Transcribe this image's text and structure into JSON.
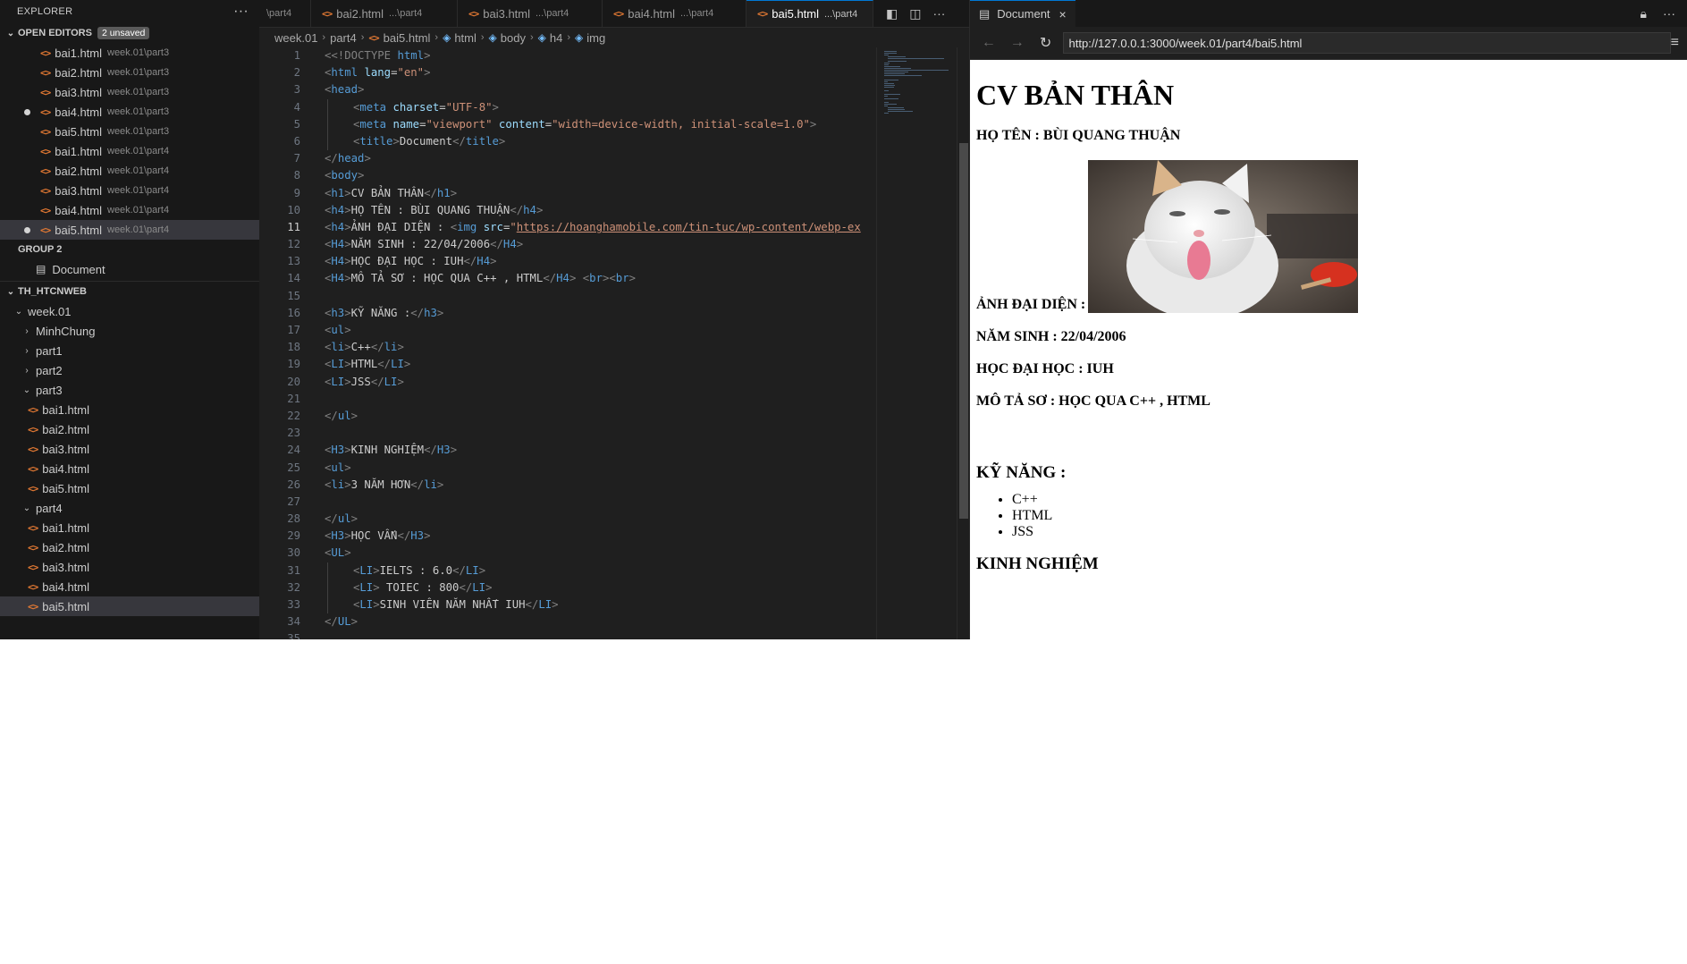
{
  "sidebar": {
    "title": "EXPLORER",
    "more": "···",
    "open_editors": {
      "label": "OPEN EDITORS",
      "badge": "2 unsaved",
      "items": [
        {
          "name": "bai1.html",
          "path": "week.01\\part3"
        },
        {
          "name": "bai2.html",
          "path": "week.01\\part3"
        },
        {
          "name": "bai3.html",
          "path": "week.01\\part3"
        },
        {
          "name": "bai4.html",
          "path": "week.01\\part3"
        },
        {
          "name": "bai5.html",
          "path": "week.01\\part3"
        },
        {
          "name": "bai1.html",
          "path": "week.01\\part4"
        },
        {
          "name": "bai2.html",
          "path": "week.01\\part4"
        },
        {
          "name": "bai3.html",
          "path": "week.01\\part4"
        },
        {
          "name": "bai4.html",
          "path": "week.01\\part4"
        },
        {
          "name": "bai5.html",
          "path": "week.01\\part4"
        }
      ],
      "group2_label": "GROUP 2",
      "group2_item": "Document"
    },
    "project": {
      "label": "TH_HTCNWEB",
      "root": "week.01",
      "folders": [
        "MinhChung",
        "part1",
        "part2"
      ],
      "part3": {
        "label": "part3",
        "files": [
          "bai1.html",
          "bai2.html",
          "bai3.html",
          "bai4.html",
          "bai5.html"
        ]
      },
      "part4": {
        "label": "part4",
        "files": [
          "bai1.html",
          "bai2.html",
          "bai3.html",
          "bai4.html",
          "bai5.html"
        ]
      }
    }
  },
  "editor": {
    "tabs": [
      {
        "name": "",
        "hint": "\\part4"
      },
      {
        "name": "bai2.html",
        "hint": "...\\part4"
      },
      {
        "name": "bai3.html",
        "hint": "...\\part4"
      },
      {
        "name": "bai4.html",
        "hint": "...\\part4"
      },
      {
        "name": "bai5.html",
        "hint": "...\\part4"
      }
    ],
    "breadcrumb": [
      "week.01",
      "part4",
      "bai5.html",
      "html",
      "body",
      "h4",
      "img"
    ],
    "current_line": 11,
    "code": {
      "doctype": "<!DOCTYPE",
      "html_kw": "html",
      "lang": "en",
      "charset": "UTF-8",
      "viewport": "viewport",
      "viewport_content": "width=device-width, initial-scale=1.0",
      "doc_title": "Document",
      "img_src": "https://hoanghamobile.com/tin-tuc/wp-content/webp-ex"
    }
  },
  "browser": {
    "tab_title": "Document",
    "close": "×",
    "url": "http://127.0.0.1:3000/week.01/part4/bai5.html",
    "page": {
      "h1": "CV BẢN THÂN",
      "name": "HỌ TÊN : BÙI QUANG THUẬN",
      "avatar_label": "ẢNH ĐẠI DIỆN :",
      "birth": "NĂM SINH : 22/04/2006",
      "university": "HỌC ĐẠI HỌC : IUH",
      "desc": "MÔ TẢ SƠ : HỌC QUA C++ , HTML",
      "skills_title": "KỸ NĂNG :",
      "skills": [
        "C++",
        "HTML",
        "JSS"
      ],
      "exp_title": "KINH NGHIỆM"
    }
  },
  "colors": {
    "accent": "#0078d4",
    "tag": "#569cd6",
    "attr": "#9cdcfe",
    "string": "#ce9178",
    "html_icon": "#e37933"
  }
}
